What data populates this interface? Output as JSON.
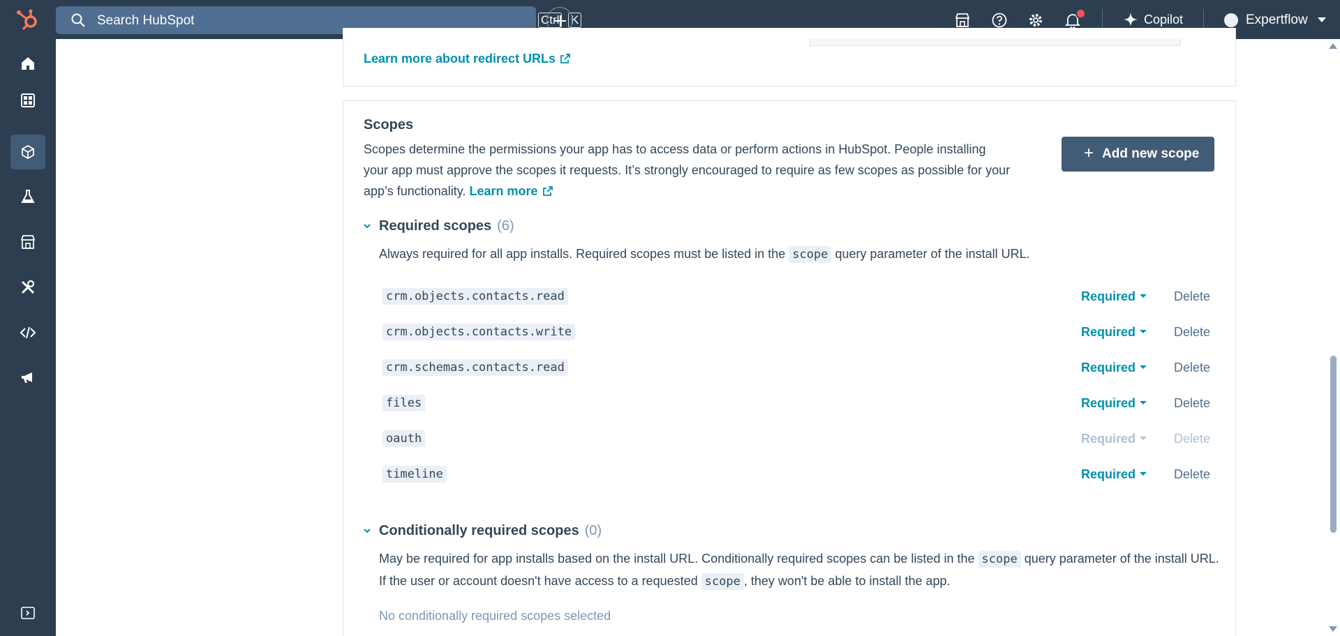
{
  "topbar": {
    "search_placeholder": "Search HubSpot",
    "shortcut_ctrl": "Ctrl",
    "shortcut_k": "K",
    "copilot_label": "Copilot",
    "account_name": "Expertflow"
  },
  "redirect": {
    "learn_more_label": "Learn more about redirect URLs"
  },
  "scopes": {
    "heading": "Scopes",
    "description": "Scopes determine the permissions your app has to access data or perform actions in HubSpot. People installing your app must approve the scopes it requests. It’s strongly encouraged to require as few scopes as possible for your app’s functionality.",
    "learn_more_label": "Learn more",
    "add_button_label": "Add new scope",
    "required": {
      "title": "Required scopes",
      "count": "(6)",
      "desc_before": "Always required for all app installs. Required scopes must be listed in the ",
      "desc_code": "scope",
      "desc_after": " query parameter of the install URL.",
      "items": [
        {
          "name": "crm.objects.contacts.read",
          "level": "Required",
          "delete": "Delete",
          "disabled": false
        },
        {
          "name": "crm.objects.contacts.write",
          "level": "Required",
          "delete": "Delete",
          "disabled": false
        },
        {
          "name": "crm.schemas.contacts.read",
          "level": "Required",
          "delete": "Delete",
          "disabled": false
        },
        {
          "name": "files",
          "level": "Required",
          "delete": "Delete",
          "disabled": false
        },
        {
          "name": "oauth",
          "level": "Required",
          "delete": "Delete",
          "disabled": true
        },
        {
          "name": "timeline",
          "level": "Required",
          "delete": "Delete",
          "disabled": false
        }
      ]
    },
    "conditional": {
      "title": "Conditionally required scopes",
      "count": "(0)",
      "desc_1": "May be required for app installs based on the install URL. Conditionally required scopes can be listed in the ",
      "desc_code_1": "scope",
      "desc_2": " query parameter of the install URL. If the user or account doesn't have access to a requested ",
      "desc_code_2": "scope",
      "desc_3": ", they won't be able to install the app.",
      "empty_label": "No conditionally required scopes selected"
    }
  },
  "colors": {
    "nav_bg": "#2d3e50",
    "accent_link": "#0091ae",
    "primary_button": "#425b76",
    "notification": "#f2545b",
    "brand_orange": "#ff7a59"
  }
}
